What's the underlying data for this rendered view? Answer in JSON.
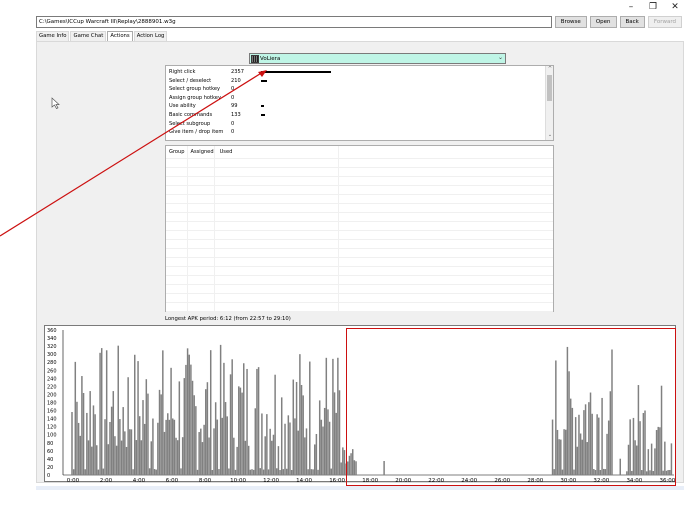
{
  "window": {
    "minimize": "–",
    "maximize": "❐",
    "close": "✕"
  },
  "toolbar": {
    "path": "C:\\Games\\ICCup Warcraft III\\Replay\\2888901.w3g",
    "browse": "Browse",
    "open": "Open",
    "back": "Back",
    "forward": "Forward"
  },
  "tabs": [
    "Game Info",
    "Game Chat",
    "Actions",
    "Action Log"
  ],
  "active_tab": "Actions",
  "player": {
    "name": "VoLiera",
    "flag_icon": "country-flag-icon"
  },
  "actions": [
    {
      "label": "Right click",
      "value": "2357",
      "bar": 1.0
    },
    {
      "label": "Select / deselect",
      "value": "210",
      "bar": 0.09
    },
    {
      "label": "Select group hotkey",
      "value": "0",
      "bar": 0
    },
    {
      "label": "Assign group hotkey",
      "value": "0",
      "bar": 0
    },
    {
      "label": "Use ability",
      "value": "99",
      "bar": 0.04
    },
    {
      "label": "Basic commands",
      "value": "133",
      "bar": 0.06
    },
    {
      "label": "Select subgroup",
      "value": "0",
      "bar": 0
    },
    {
      "label": "Give item / drop item",
      "value": "0",
      "bar": 0
    }
  ],
  "groups": {
    "headers": [
      "Group",
      "Assigned",
      "Used"
    ]
  },
  "apk_text": "Longest APK period: 6:12 (from 22:57 to 29:10)",
  "chart_data": {
    "type": "bar",
    "y_ticks": [
      "360",
      "340",
      "320",
      "300",
      "280",
      "260",
      "240",
      "220",
      "200",
      "180",
      "160",
      "140",
      "120",
      "100",
      "80",
      "60",
      "40",
      "20",
      "0"
    ],
    "x_ticks": [
      "0:00",
      "2:00",
      "4:00",
      "6:00",
      "8:00",
      "10:00",
      "12:00",
      "14:00",
      "16:00",
      "18:00",
      "20:00",
      "22:00",
      "24:00",
      "26:00",
      "28:00",
      "30:00",
      "32:00",
      "34:00",
      "36:00"
    ],
    "ylim": [
      0,
      360
    ],
    "xlim": [
      0,
      37
    ],
    "segments": [
      {
        "from": 0.5,
        "to": 16.7,
        "level": 0.55
      },
      {
        "from": 16.7,
        "to": 17.6,
        "level": 0.12
      },
      {
        "from": 29.6,
        "to": 33.3,
        "level": 0.55
      },
      {
        "from": 34.1,
        "to": 36.9,
        "level": 0.4
      }
    ],
    "colors": {
      "bar": "#808080",
      "highlight": "#cc1010"
    }
  },
  "annotation_color": "#cc1010"
}
